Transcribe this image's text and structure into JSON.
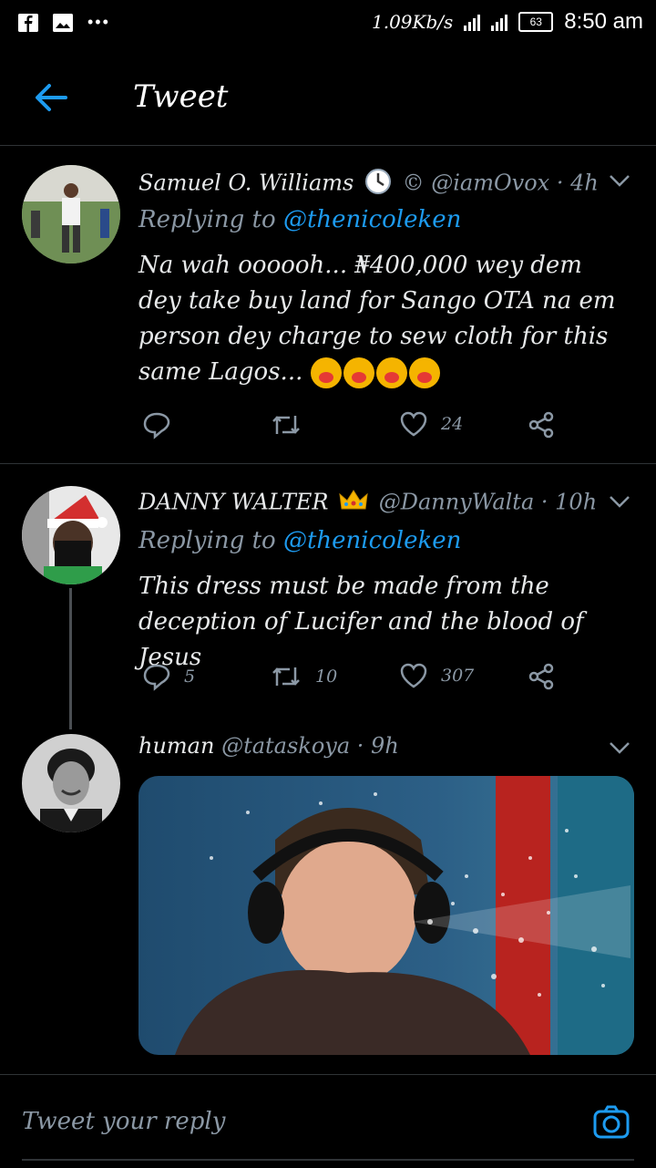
{
  "status_bar": {
    "speed": "1.09Kb/s",
    "battery": "63",
    "time": "8:50 am"
  },
  "header": {
    "title": "Tweet"
  },
  "tweets": [
    {
      "name": "Samuel O. Williams",
      "handle": "© @iamOvox · 4h",
      "replying_prefix": "Replying to ",
      "replying_to": "@thenicoleken",
      "text": "Na wah oooooh... ₦400,000 wey dem dey take buy land for Sango OTA na em person dey charge to sew cloth for this same Lagos...",
      "emojis": 4,
      "replies": "",
      "retweets": "",
      "likes": "24"
    },
    {
      "name": "DANNY WALTER",
      "handle": "@DannyWalta · 10h",
      "replying_prefix": "Replying to ",
      "replying_to": "@thenicoleken",
      "text": "This dress must be made from the deception of Lucifer and the blood of Jesus",
      "replies": "5",
      "retweets": "10",
      "likes": "307"
    },
    {
      "name": "human",
      "handle": "@tataskoya · 9h"
    }
  ],
  "reply_bar": {
    "placeholder": "Tweet your reply"
  },
  "colors": {
    "background": "#000000",
    "accent": "#1d9bf0",
    "muted": "#8b98a5",
    "divider": "#2f3336"
  },
  "icons": [
    "facebook-icon",
    "gallery-icon",
    "back-arrow-icon",
    "clock-emoji-icon",
    "crown-emoji-icon",
    "chevron-down-icon",
    "reply-icon",
    "retweet-icon",
    "like-icon",
    "share-icon",
    "camera-icon"
  ]
}
